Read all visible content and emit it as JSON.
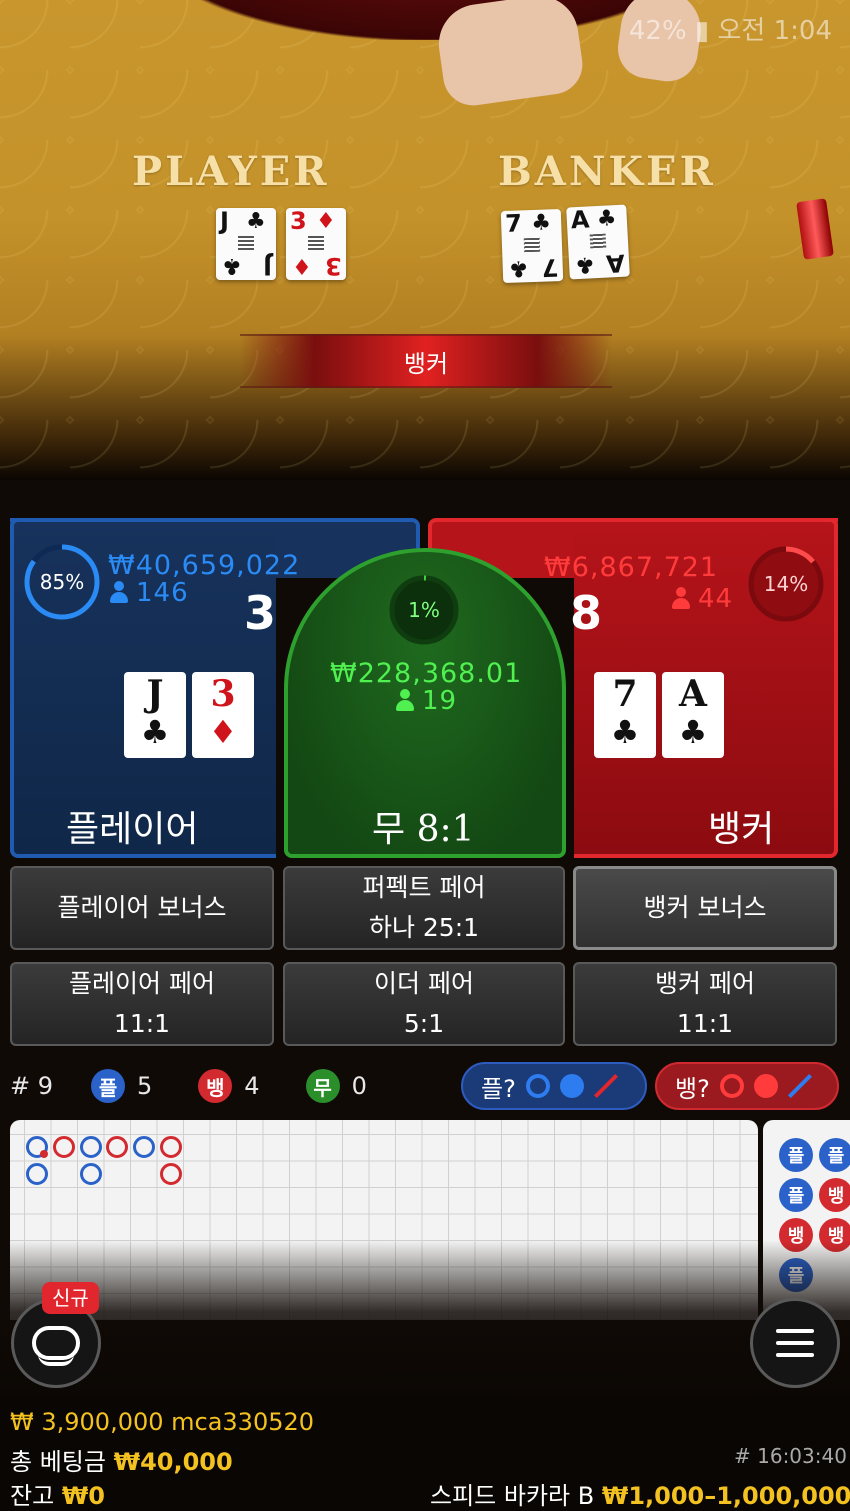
{
  "status_bar": {
    "battery": "42%",
    "time": "오전 1:04"
  },
  "table": {
    "player_label": "PLAYER",
    "banker_label": "BANKER",
    "player_cards": [
      {
        "rank": "J",
        "suit": "♣",
        "color": "black"
      },
      {
        "rank": "3",
        "suit": "♦",
        "color": "red"
      }
    ],
    "banker_cards": [
      {
        "rank": "7",
        "suit": "♣",
        "color": "black"
      },
      {
        "rank": "A",
        "suit": "♣",
        "color": "black"
      }
    ],
    "result": "뱅커"
  },
  "bets": {
    "player": {
      "percent": "85%",
      "percent_value": 0.85,
      "amount": "₩40,659,022",
      "count": "146",
      "score": "3",
      "name": "플레이어",
      "cards": [
        {
          "rank": "J",
          "suit": "♣"
        },
        {
          "rank": "3",
          "suit": "♦"
        }
      ]
    },
    "tie": {
      "percent": "1%",
      "percent_value": 0.01,
      "amount": "₩228,368.01",
      "count": "19",
      "name": "무 8:1"
    },
    "banker": {
      "percent": "14%",
      "percent_value": 0.14,
      "amount": "₩6,867,721",
      "count": "44",
      "score": "8",
      "name": "뱅커",
      "cards": [
        {
          "rank": "7",
          "suit": "♣"
        },
        {
          "rank": "A",
          "suit": "♣"
        }
      ]
    }
  },
  "side_bets": {
    "player_bonus": {
      "line1": "플레이어 보너스"
    },
    "perfect_pair": {
      "line1": "퍼펙트 페어",
      "line2": "하나 25:1"
    },
    "banker_bonus": {
      "line1": "뱅커 보너스"
    },
    "player_pair": {
      "line1": "플레이어 페어",
      "line2": "11:1"
    },
    "either_pair": {
      "line1": "이더 페어",
      "line2": "5:1"
    },
    "banker_pair": {
      "line1": "뱅커 페어",
      "line2": "11:1"
    }
  },
  "stats": {
    "round_label": "# 9",
    "player_badge": "플",
    "player_count": "5",
    "banker_badge": "뱅",
    "banker_count": "4",
    "tie_badge": "무",
    "tie_count": "0",
    "player_predict": "플?",
    "banker_predict": "뱅?"
  },
  "side_road": {
    "labels": [
      "플",
      "플",
      "플",
      "뱅",
      "뱅",
      "뱅",
      "플"
    ]
  },
  "buttons": {
    "new_badge": "신규"
  },
  "footer": {
    "balance_line": "₩ 3,900,000 mca330520",
    "total_bet_label": "총 베팅금",
    "total_bet_value": "₩40,000",
    "balance_label": "잔고",
    "balance_value": "₩0",
    "game_id": "# 16:03:40",
    "table_name": "스피드 바카라 B",
    "limits": "₩1,000–1,000,000"
  },
  "colors": {
    "player_blue": "#1f5bb0",
    "banker_red": "#e2272d",
    "tie_green": "#2ea02e",
    "gold": "#f3c221"
  }
}
